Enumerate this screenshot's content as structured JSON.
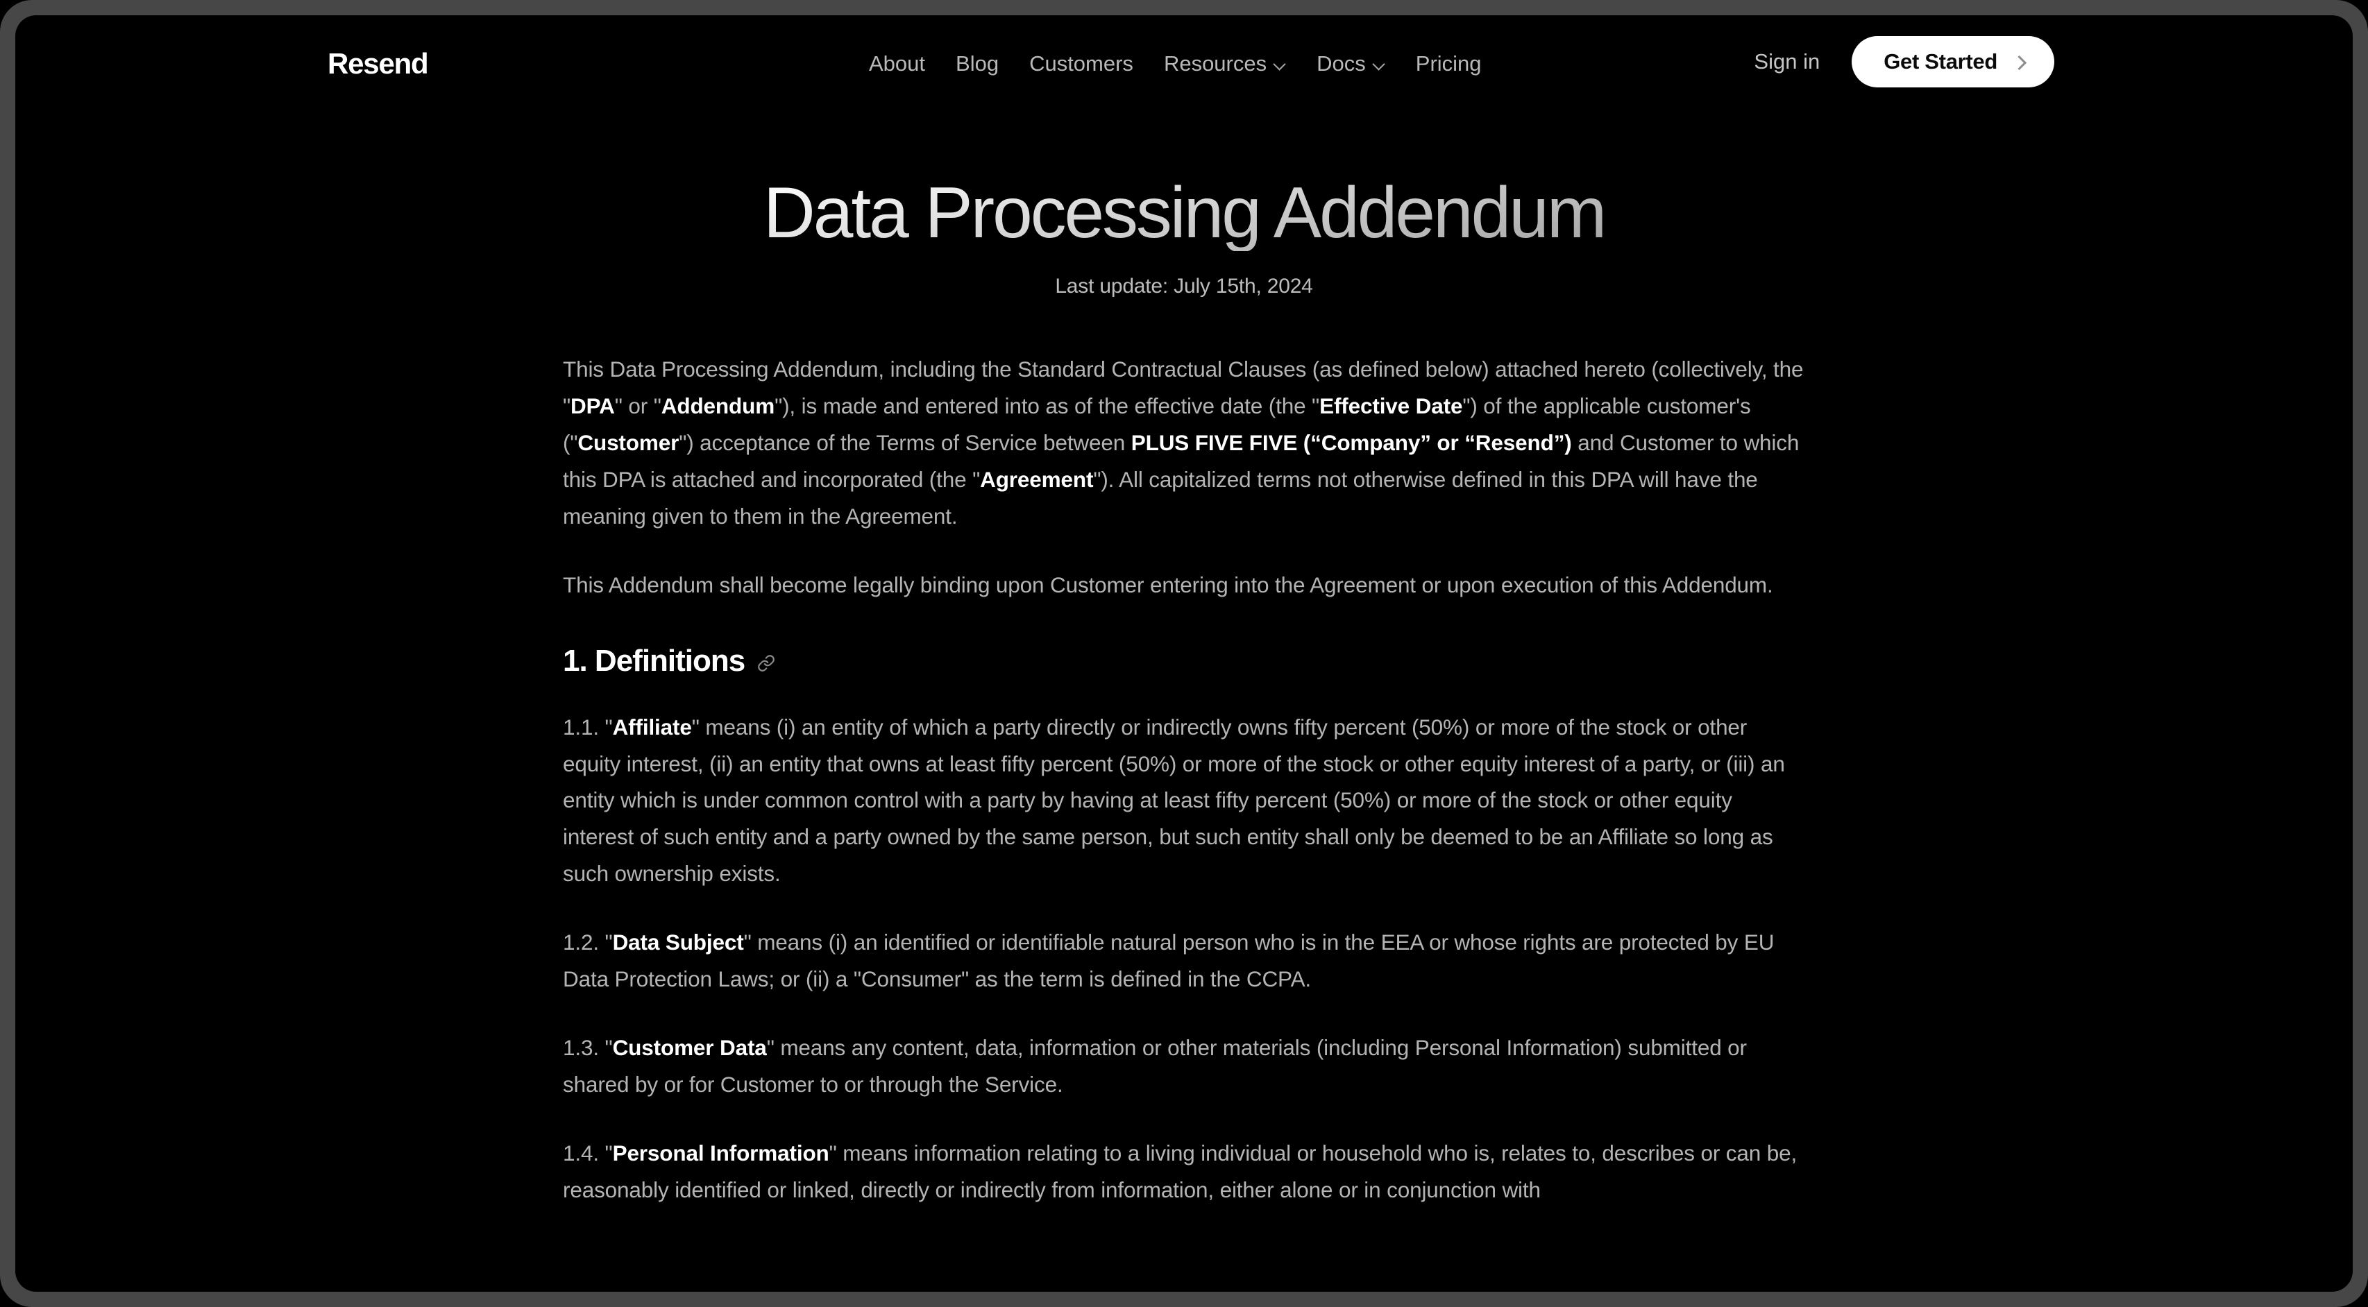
{
  "header": {
    "logo": "Resend",
    "nav": [
      {
        "label": "About",
        "has_chevron": false,
        "icon": null
      },
      {
        "label": "Blog",
        "has_chevron": false,
        "icon": null
      },
      {
        "label": "Customers",
        "has_chevron": false,
        "icon": null
      },
      {
        "label": "Resources",
        "has_chevron": true,
        "icon": "chevron-down-icon"
      },
      {
        "label": "Docs",
        "has_chevron": true,
        "icon": "chevron-down-icon"
      },
      {
        "label": "Pricing",
        "has_chevron": false,
        "icon": null
      }
    ],
    "signin_label": "Sign in",
    "cta_label": "Get Started",
    "cta_icon": "chevron-right-icon"
  },
  "page": {
    "title": "Data Processing Addendum",
    "subtitle": "Last update: July 15th, 2024"
  },
  "document": {
    "intro_paragraph_1": {
      "t1": "This Data Processing Addendum, including the Standard Contractual Clauses (as defined below) attached hereto (collectively, the \"",
      "b1": "DPA",
      "t2": "\" or \"",
      "b2": "Addendum",
      "t3": "\"), is made and entered into as of the effective date (the \"",
      "b3": "Effective Date",
      "t4": "\") of the applicable customer's (\"",
      "b4": "Customer",
      "t5": "\") acceptance of the Terms of Service between ",
      "b5": "PLUS FIVE FIVE (“Company” or “Resend”)",
      "t6": " and Customer to which this DPA is attached and incorporated (the \"",
      "b6": "Agreement",
      "t7": "\"). All capitalized terms not otherwise defined in this DPA will have the meaning given to them in the Agreement."
    },
    "intro_paragraph_2": "This Addendum shall become legally binding upon Customer entering into the Agreement or upon execution of this Addendum.",
    "section_1": {
      "heading": "1. Definitions",
      "anchor_icon": "link-icon",
      "clauses": [
        {
          "number": "1.1. \"",
          "term": "Affiliate",
          "body": "\" means (i) an entity of which a party directly or indirectly owns fifty percent (50%) or more of the stock or other equity interest, (ii) an entity that owns at least fifty percent (50%) or more of the stock or other equity interest of a party, or (iii) an entity which is under common control with a party by having at least fifty percent (50%) or more of the stock or other equity interest of such entity and a party owned by the same person, but such entity shall only be deemed to be an Affiliate so long as such ownership exists."
        },
        {
          "number": "1.2. \"",
          "term": "Data Subject",
          "body": "\" means (i) an identified or identifiable natural person who is in the EEA or whose rights are protected by EU Data Protection Laws; or (ii) a \"Consumer\" as the term is defined in the CCPA."
        },
        {
          "number": "1.3. \"",
          "term": "Customer Data",
          "body": "\" means any content, data, information or other materials (including Personal Information) submitted or shared by or for Customer to or through the Service."
        },
        {
          "number": "1.4. \"",
          "term": "Personal Information",
          "body": "\" means information relating to a living individual or household who is, relates to, describes or can be, reasonably identified or linked, directly or indirectly from information, either alone or in conjunction with"
        }
      ]
    }
  },
  "colors": {
    "background": "#000000",
    "bezel": "#474747",
    "body_text": "#b4b4b4",
    "heading_text": "#ffffff",
    "nav_text": "#b9b9b9",
    "cta_background": "#ffffff",
    "cta_text": "#0a0a0a"
  }
}
